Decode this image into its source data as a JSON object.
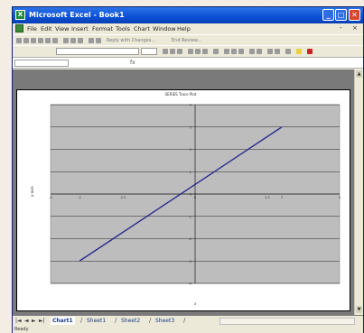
{
  "window": {
    "title": "Microsoft Excel - Book1",
    "app_icon_glyph": "X",
    "minimize_glyph": "_",
    "maximize_glyph": "□",
    "close_glyph": "✕"
  },
  "menubar": {
    "items": [
      "File",
      "Edit",
      "View",
      "Insert",
      "Format",
      "Tools",
      "Chart",
      "Window",
      "Help"
    ],
    "doc_minimize_glyph": "-",
    "doc_close_glyph": "×"
  },
  "toolbar": {
    "reply_text": "Reply with Changes...",
    "end_review_text": "End Review..."
  },
  "formula_bar": {
    "fx_label": "fx"
  },
  "chart": {
    "title": "SERIES Trace Plot",
    "ylabel": "y-axis",
    "xlabel": "x",
    "colors": {
      "plot_area": "#bdbdbd",
      "line": "#2b2b8f",
      "gridline": "#000000"
    }
  },
  "chart_data": {
    "type": "line",
    "x": [
      -4,
      3
    ],
    "y": [
      -3,
      3
    ],
    "xlim": [
      -5,
      5
    ],
    "ylim": [
      -4,
      4
    ],
    "x_ticks": [
      "-5",
      "-4",
      "-2.5",
      "0",
      "2.5",
      "3",
      "5"
    ],
    "y_ticks": [
      "4",
      "3",
      "2",
      "1",
      "0",
      "-1",
      "-2",
      "-3",
      "-4"
    ],
    "grid": true
  },
  "sheet_tabs": {
    "nav": [
      "|◄",
      "◄",
      "►",
      "►|"
    ],
    "tabs": [
      "Chart1",
      "Sheet1",
      "Sheet2",
      "Sheet3"
    ],
    "active": 0
  },
  "status": {
    "text": "Ready"
  }
}
